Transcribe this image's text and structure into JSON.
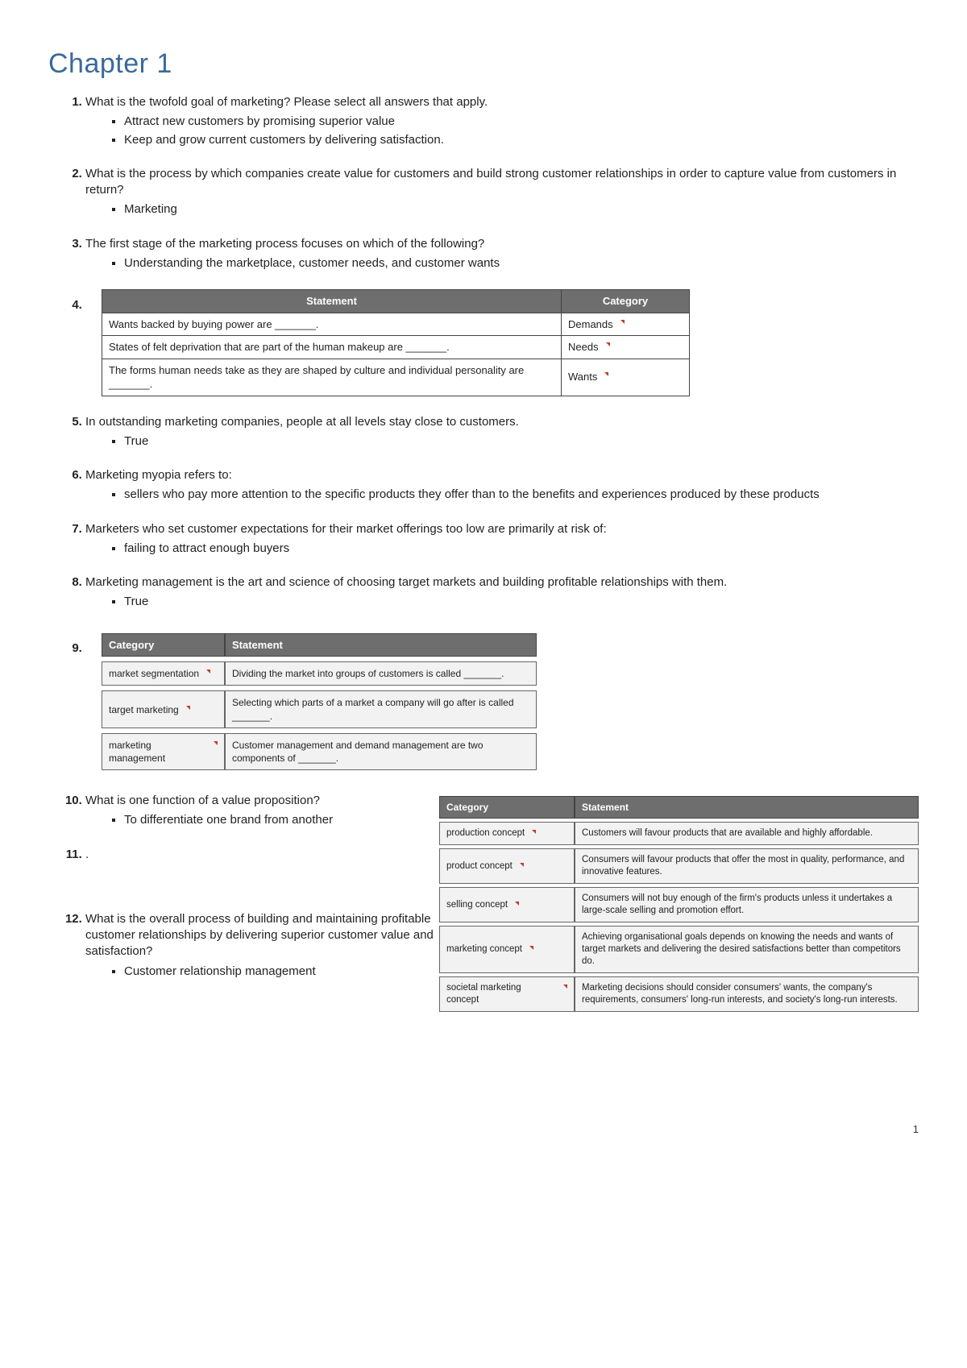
{
  "title": "Chapter 1",
  "page_number": "1",
  "questions": {
    "q1": {
      "text": "What is the twofold goal of marketing? Please select all answers that apply.",
      "answers": [
        "Attract new customers by promising superior value",
        "Keep and grow current customers by delivering satisfaction."
      ]
    },
    "q2": {
      "text": "What is the process by which companies create value for customers and build strong customer relationships in order to capture value from customers in return?",
      "answers": [
        "Marketing"
      ]
    },
    "q3": {
      "text": "The first stage of the marketing process focuses on which of the following?",
      "answers": [
        "Understanding the marketplace, customer needs, and customer wants"
      ]
    },
    "q4": {
      "table_headers": [
        "Statement",
        "Category"
      ],
      "rows": [
        {
          "statement": "Wants backed by buying power are _______.",
          "category": "Demands"
        },
        {
          "statement": "States of felt deprivation that are part of the human makeup are _______.",
          "category": "Needs"
        },
        {
          "statement": "The forms human needs take as they are shaped by culture and individual personality are _______.",
          "category": "Wants"
        }
      ]
    },
    "q5": {
      "text": "In outstanding marketing companies, people at all levels stay close to customers.",
      "answers": [
        "True"
      ]
    },
    "q6": {
      "text": "Marketing myopia refers to:",
      "answers": [
        "sellers who pay more attention to the specific products they offer than to the benefits and experiences produced by these products"
      ]
    },
    "q7": {
      "text": "Marketers who set customer expectations for their market offerings too low are primarily at risk of:",
      "answers": [
        "failing to attract enough buyers"
      ]
    },
    "q8": {
      "text": "Marketing management is the art and science of choosing target markets and building profitable relationships with them.",
      "answers": [
        "True"
      ]
    },
    "q9": {
      "table_headers": [
        "Category",
        "Statement"
      ],
      "rows": [
        {
          "category": "market segmentation",
          "statement": "Dividing the market into groups of customers is called _______."
        },
        {
          "category": "target marketing",
          "statement": "Selecting which parts of a market a company will go after is called _______."
        },
        {
          "category": "marketing management",
          "statement": "Customer management and demand management are two components of _______."
        }
      ]
    },
    "q10": {
      "text": "What is one function of a value proposition?",
      "answers": [
        "To differentiate one brand from another"
      ]
    },
    "q11": {
      "text": ".",
      "table_headers": [
        "Category",
        "Statement"
      ],
      "rows": [
        {
          "category": "production concept",
          "statement": "Customers will favour products that are available and highly affordable."
        },
        {
          "category": "product concept",
          "statement": "Consumers will favour products that offer the most in quality, performance, and innovative features."
        },
        {
          "category": "selling concept",
          "statement": "Consumers will not buy enough of the firm's products unless it undertakes a large-scale selling and promotion effort."
        },
        {
          "category": "marketing concept",
          "statement": "Achieving organisational goals depends on knowing the needs and wants of target markets and delivering the desired satisfactions better than competitors do."
        },
        {
          "category": "societal marketing concept",
          "statement": "Marketing decisions should consider consumers' wants, the company's requirements, consumers' long-run interests, and society's long-run interests."
        }
      ]
    },
    "q12": {
      "text": "What is the overall process of building and maintaining profitable customer relationships by delivering superior customer value and satisfaction?",
      "answers": [
        "Customer relationship management"
      ]
    }
  }
}
